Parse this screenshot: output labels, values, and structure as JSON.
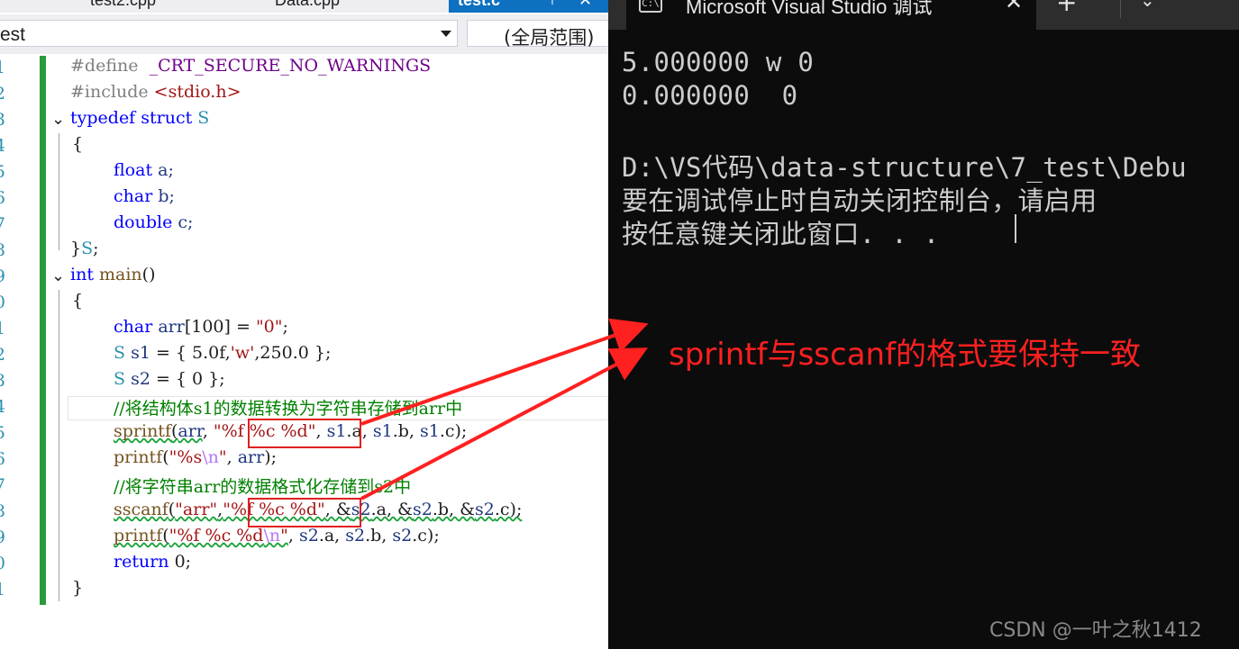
{
  "editor": {
    "tabs": [
      "test2.cpp",
      "Data.cpp"
    ],
    "active_tab": "test.c",
    "active_tab_pin": "⊤",
    "active_tab_close": "✕",
    "scope_left": "est",
    "scope_right": "(全局范围)",
    "line_numbers": [
      "1",
      "2",
      "3",
      "4",
      "5",
      "6",
      "7",
      "8",
      "9",
      "0",
      "1",
      "2",
      "3",
      "4",
      "5",
      "6",
      "7",
      "8",
      "9",
      "0",
      "1"
    ],
    "lines": {
      "l1_a": "#define",
      "l1_b": "_CRT_SECURE_NO_WARNINGS",
      "l2_a": "#include",
      "l2_b": "<stdio.h>",
      "l3_a": "typedef",
      "l3_b": "struct",
      "l3_c": "S",
      "l4": "{",
      "l5_a": "float",
      "l5_b": "a;",
      "l6_a": "char",
      "l6_b": "b;",
      "l7_a": "double",
      "l7_b": "c;",
      "l8_a": "}",
      "l8_b": "S",
      "l8_c": ";",
      "l9_a": "int",
      "l9_b": "main",
      "l9_c": "()",
      "l10": "{",
      "l11_a": "char",
      "l11_b": "arr",
      "l11_c": "[100] = ",
      "l11_d": "\"0\"",
      "l11_e": ";",
      "l12_a": "S",
      "l12_b": "s1",
      "l12_c": " = { 5.0f,",
      "l12_d": "'w'",
      "l12_e": ",250.0 };",
      "l13_a": "S",
      "l13_b": "s2",
      "l13_c": " = { 0 };",
      "l14": "//将结构体s1的数据转换为字符串存储到arr中",
      "l15_a": "sprintf",
      "l15_b": "(",
      "l15_c": "arr",
      "l15_d": ", ",
      "l15_e": "\"%f %c %d\"",
      "l15_f": ", ",
      "l15_g": "s1",
      "l15_h": ".a, ",
      "l15_i": "s1",
      "l15_j": ".b, ",
      "l15_k": "s1",
      "l15_l": ".c);",
      "l16_a": "printf",
      "l16_b": "(",
      "l16_c": "\"%s",
      "l16_d": "\\n",
      "l16_e": "\"",
      "l16_f": ", ",
      "l16_g": "arr",
      "l16_h": ");",
      "l17": "//将字符串arr的数据格式化存储到s2中",
      "l18_a": "sscanf",
      "l18_b": "(",
      "l18_c": "\"arr\"",
      "l18_d": ",",
      "l18_e": "\"%f %c %d\"",
      "l18_f": ", &",
      "l18_g": "s2",
      "l18_h": ".a, &",
      "l18_i": "s2",
      "l18_j": ".b, &",
      "l18_k": "s2",
      "l18_l": ".c);",
      "l19_a": "printf",
      "l19_b": "(",
      "l19_c": "\"%f %c %d",
      "l19_d": "\\n",
      "l19_e": "\"",
      "l19_f": ", ",
      "l19_g": "s2",
      "l19_h": ".a, ",
      "l19_i": "s2",
      "l19_j": ".b, ",
      "l19_k": "s2",
      "l19_l": ".c);",
      "l20_a": "return",
      "l20_b": " 0;",
      "l21": "}"
    }
  },
  "console": {
    "icon_text": "C:\\",
    "title": "Microsoft Visual Studio 调试",
    "close": "✕",
    "new_tab": "+",
    "dropdown": "⌄",
    "output": [
      "5.000000 w 0",
      "0.000000  0",
      "",
      "D:\\VS代码\\data-structure\\7_test\\Debu",
      "要在调试停止时自动关闭控制台，请启用",
      "按任意键关闭此窗口. . ."
    ]
  },
  "annotation": "sprintf与sscanf的格式要保持一致",
  "watermark": "CSDN @一叶之秋1412",
  "colors": {
    "annotation": "#ff2020",
    "editor_keyword": "#0000ff",
    "editor_string": "#a31515",
    "editor_comment": "#008000",
    "console_bg": "#0c0c0c"
  }
}
